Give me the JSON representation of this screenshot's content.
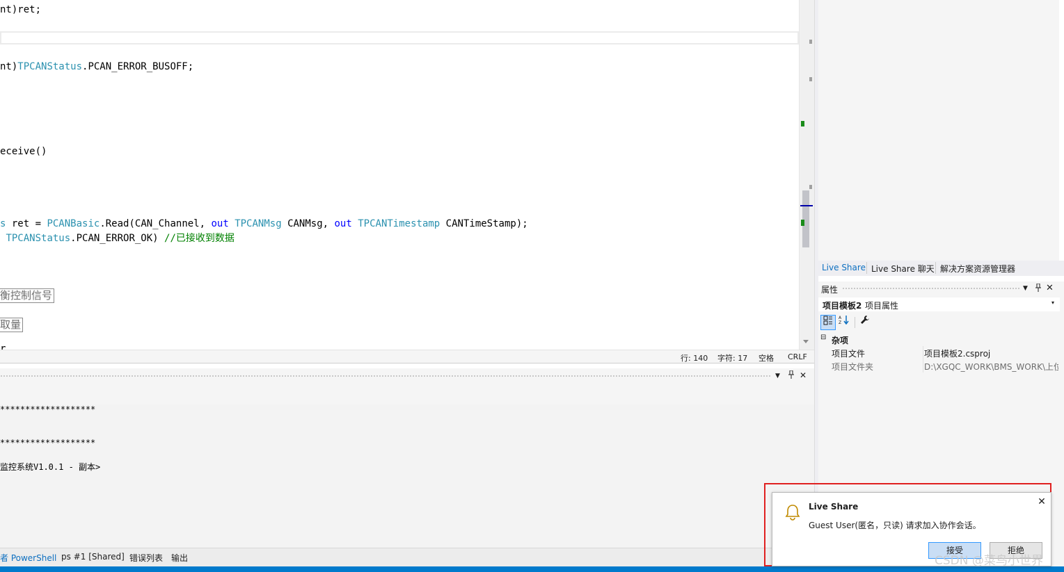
{
  "editor": {
    "lines": [
      {
        "segments": [
          {
            "t": "nt)ret;",
            "c": "pl"
          }
        ]
      },
      {
        "segments": [
          {
            "t": "nt)",
            "c": "pl"
          },
          {
            "t": "TPCANStatus",
            "c": "ty"
          },
          {
            "t": ".PCAN_ERROR_BUSOFF;",
            "c": "pl"
          }
        ]
      },
      {
        "segments": [
          {
            "t": "eceive()",
            "c": "pl"
          }
        ]
      },
      {
        "segments": [
          {
            "t": "s",
            "c": "ty"
          },
          {
            "t": " ret = ",
            "c": "pl"
          },
          {
            "t": "PCANBasic",
            "c": "ty"
          },
          {
            "t": ".Read(CAN_Channel, ",
            "c": "pl"
          },
          {
            "t": "out",
            "c": "kw"
          },
          {
            "t": " ",
            "c": "pl"
          },
          {
            "t": "TPCANMsg",
            "c": "ty"
          },
          {
            "t": " CANMsg, ",
            "c": "pl"
          },
          {
            "t": "out",
            "c": "kw"
          },
          {
            "t": " ",
            "c": "pl"
          },
          {
            "t": "TPCANTimestamp",
            "c": "ty"
          },
          {
            "t": " CANTimeStamp);",
            "c": "pl"
          }
        ]
      },
      {
        "segments": [
          {
            "t": " ",
            "c": "pl"
          },
          {
            "t": "TPCANStatus",
            "c": "ty"
          },
          {
            "t": ".PCAN_ERROR_OK) ",
            "c": "pl"
          },
          {
            "t": "//已接收到数据",
            "c": "cm"
          }
        ]
      }
    ],
    "regions": [
      "衡控制信号",
      "取量"
    ],
    "partial_bottom": "r   . . ."
  },
  "editor_status": {
    "line": "行: 140",
    "char": "字符: 17",
    "indent": "空格",
    "eol": "CRLF"
  },
  "terminal": {
    "lines": [
      "*******************",
      "*******************",
      "监控系统V1.0.1 - 副本>"
    ]
  },
  "bottom_tabs": [
    {
      "label": "者 PowerShell",
      "active": true
    },
    {
      "label": "ps #1 [Shared]",
      "active": false
    },
    {
      "label": "错误列表",
      "active": false
    },
    {
      "label": "输出",
      "active": false
    }
  ],
  "right_tabs": [
    {
      "label": "Live Share",
      "active": true
    },
    {
      "label": "Live Share 聊天",
      "active": false
    },
    {
      "label": "解决方案资源管理器",
      "active": false
    }
  ],
  "properties": {
    "title": "属性",
    "object_name": "项目模板2",
    "object_type": "项目属性",
    "category": "杂项",
    "rows": [
      {
        "name": "项目文件",
        "value": "项目模板2.csproj"
      },
      {
        "name": "项目文件夹",
        "value": "D:\\XGQC_WORK\\BMS_WORK\\上位"
      }
    ]
  },
  "toast": {
    "title": "Live Share",
    "message": "Guest User(匿名，只读) 请求加入协作会话。",
    "accept_label": "接受",
    "reject_label": "拒绝"
  },
  "watermark": "CSDN @菜鸟小世界",
  "colors": {
    "accent": "#007acc",
    "highlight_border": "#e02020",
    "keyword": "#0000ff",
    "type": "#2b91af",
    "comment": "#008000"
  }
}
